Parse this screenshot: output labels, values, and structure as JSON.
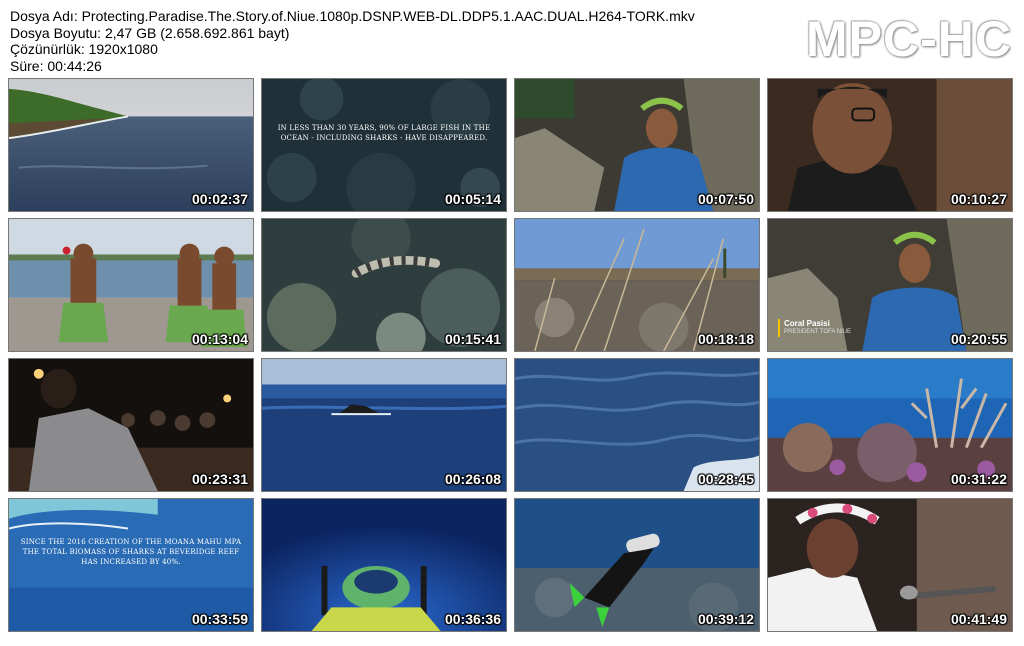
{
  "file_info": {
    "name_line": "Dosya Adı: Protecting.Paradise.The.Story.of.Niue.1080p.DSNP.WEB-DL.DDP5.1.AAC.DUAL.H264-TORK.mkv",
    "size_line": "Dosya Boyutu: 2,47 GB (2.658.692.861 bayt)",
    "resolution_line": "Çözünürlük: 1920x1080",
    "duration_line": "Süre: 00:44:26"
  },
  "logo": "MPC-HC",
  "thumbnails": [
    {
      "time": "00:02:37",
      "scene": "coastline-cliff"
    },
    {
      "time": "00:05:14",
      "scene": "reef-text",
      "caption": "IN LESS THAN 30 YEARS, 90% OF LARGE FISH IN THE OCEAN - INCLUDING SHARKS - HAVE DISAPPEARED."
    },
    {
      "time": "00:07:50",
      "scene": "woman-rocks"
    },
    {
      "time": "00:10:27",
      "scene": "man-glasses"
    },
    {
      "time": "00:13:04",
      "scene": "dancers"
    },
    {
      "time": "00:15:41",
      "scene": "sea-snake"
    },
    {
      "time": "00:18:18",
      "scene": "dry-branches"
    },
    {
      "time": "00:20:55",
      "scene": "woman-interview",
      "name": "Coral Pasisi",
      "role": "PRESIDENT TOFA NIUE"
    },
    {
      "time": "00:23:31",
      "scene": "night-crowd"
    },
    {
      "time": "00:26:08",
      "scene": "ocean-rock"
    },
    {
      "time": "00:28:45",
      "scene": "ocean-waves"
    },
    {
      "time": "00:31:22",
      "scene": "coral-reef"
    },
    {
      "time": "00:33:59",
      "scene": "aerial-reef",
      "caption": "SINCE THE 2016 CREATION OF THE MOANA MAHU MPA THE TOTAL BIOMASS OF SHARKS AT BEVERIDGE REEF HAS INCREASED BY 40%."
    },
    {
      "time": "00:36:36",
      "scene": "submersible"
    },
    {
      "time": "00:39:12",
      "scene": "diver"
    },
    {
      "time": "00:41:49",
      "scene": "woman-microphone"
    }
  ]
}
